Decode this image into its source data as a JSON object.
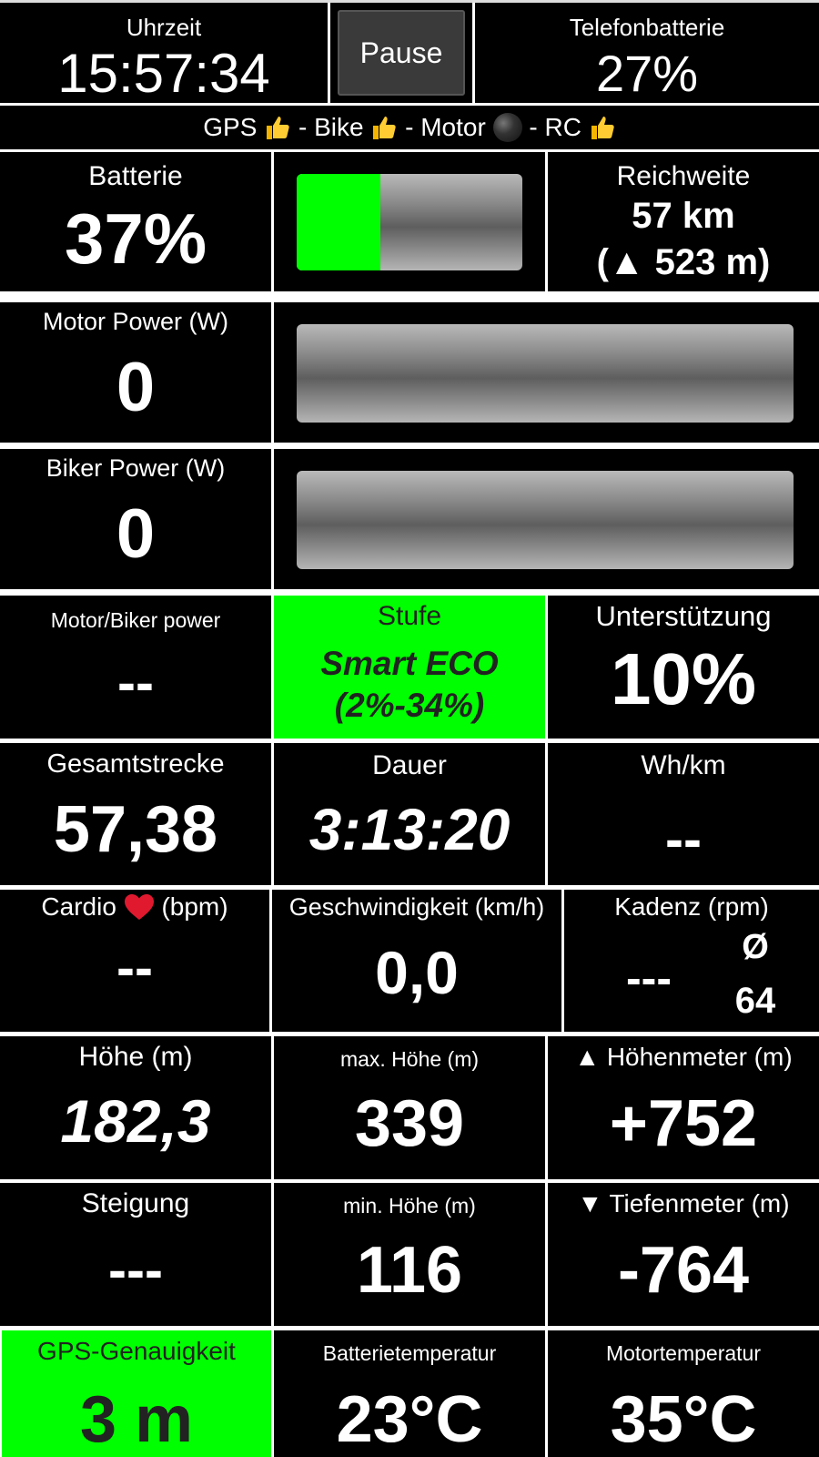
{
  "header": {
    "time_label": "Uhrzeit",
    "time_value": "15:57:34",
    "pause_label": "Pause",
    "phone_battery_label": "Telefonbatterie",
    "phone_battery_value": "27%"
  },
  "status_bar": {
    "gps_label": "GPS",
    "bike_label": "Bike",
    "motor_label": "Motor",
    "rc_label": "RC",
    "separator": " - ",
    "gps_icon": "thumbs-up-icon",
    "bike_icon": "thumbs-up-icon",
    "motor_icon": "black-circle-icon",
    "rc_icon": "thumbs-up-icon"
  },
  "battery": {
    "label": "Batterie",
    "value": "37%",
    "level": 0.37,
    "fill_color": "#00ff00"
  },
  "range": {
    "label": "Reichweite",
    "value": "57 km",
    "elevation": "(▲ 523 m)"
  },
  "motor_power": {
    "label": "Motor Power (W)",
    "value": "0"
  },
  "biker_power": {
    "label": "Biker Power (W)",
    "value": "0"
  },
  "ratio": {
    "label": "Motor/Biker power",
    "value": "--"
  },
  "level": {
    "label": "Stufe",
    "mode": "Smart ECO",
    "range": "(2%-34%)",
    "color": "#00ff00"
  },
  "support": {
    "label": "Unterstützung",
    "value": "10%"
  },
  "distance": {
    "label": "Gesamtstrecke",
    "value": "57,38"
  },
  "duration": {
    "label": "Dauer",
    "value": "3:13:20"
  },
  "consumption": {
    "label": "Wh/km",
    "value": "--"
  },
  "cardio": {
    "label_prefix": "Cardio",
    "label_suffix": "(bpm)",
    "value": "--",
    "icon": "heart-icon"
  },
  "speed": {
    "label": "Geschwindigkeit (km/h)",
    "value": "0,0"
  },
  "cadence": {
    "label": "Kadenz (rpm)",
    "value": "---",
    "avg_symbol": "Ø",
    "avg_value": "64"
  },
  "altitude": {
    "label": "Höhe (m)",
    "value": "182,3"
  },
  "max_altitude": {
    "label": "max. Höhe (m)",
    "value": "339"
  },
  "ascent": {
    "label": "▲ Höhenmeter (m)",
    "value": "+752"
  },
  "gradient": {
    "label": "Steigung",
    "value": "---"
  },
  "min_altitude": {
    "label": "min. Höhe (m)",
    "value": "116"
  },
  "descent": {
    "label": "▼ Tiefenmeter (m)",
    "value": "-764"
  },
  "gps_accuracy": {
    "label": "GPS-Genauigkeit",
    "value": "3 m",
    "color": "#00ff00"
  },
  "battery_temp": {
    "label": "Batterietemperatur",
    "value": "23°C"
  },
  "motor_temp": {
    "label": "Motortemperatur",
    "value": "35°C"
  }
}
